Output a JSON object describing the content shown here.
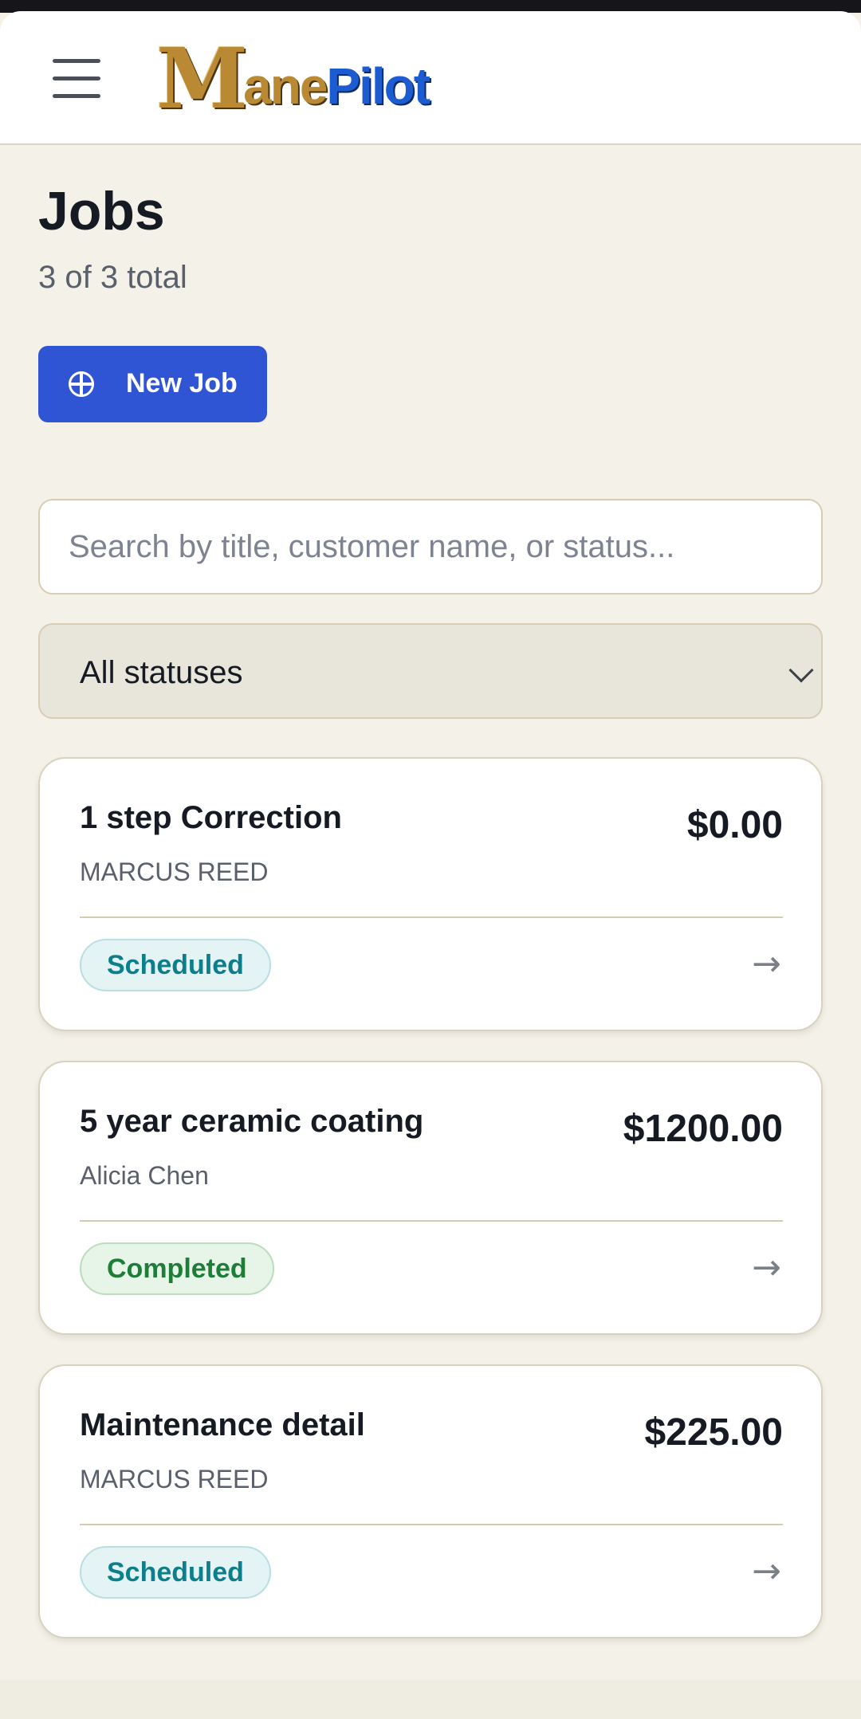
{
  "header": {
    "menu_icon": "hamburger-menu-icon",
    "logo": {
      "mark": "M",
      "gold": "ane",
      "blue": "Pilot"
    }
  },
  "page": {
    "title": "Jobs",
    "subtitle": "3 of 3 total",
    "new_job_label": "New Job",
    "new_job_icon": "plus-circle-icon"
  },
  "search": {
    "placeholder": "Search by title, customer name, or status...",
    "value": ""
  },
  "status_filter": {
    "selected": "All statuses"
  },
  "jobs": [
    {
      "title": "1 step Correction",
      "customer": "MARCUS REED",
      "price": "$0.00",
      "status": "Scheduled"
    },
    {
      "title": "5 year ceramic coating",
      "customer": "Alicia Chen",
      "price": "$1200.00",
      "status": "Completed"
    },
    {
      "title": "Maintenance detail",
      "customer": "MARCUS REED",
      "price": "$225.00",
      "status": "Scheduled"
    }
  ],
  "colors": {
    "accent": "#2f55d4",
    "background": "#f4f1e8",
    "scheduled": "#0d7f8c",
    "completed": "#1f7d3a"
  }
}
